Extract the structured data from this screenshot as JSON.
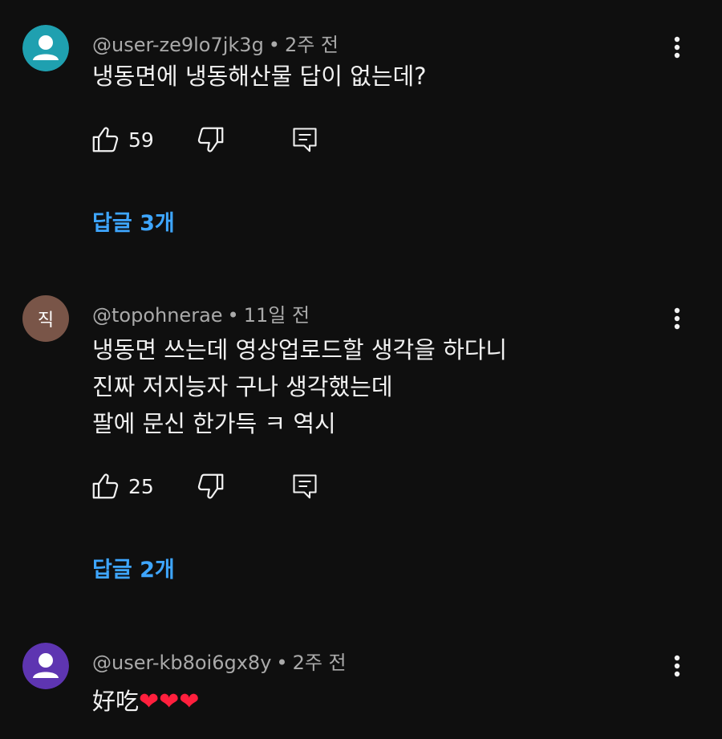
{
  "comments": [
    {
      "handle": "@user-ze9lo7jk3g",
      "separator": "•",
      "time": "2주 전",
      "avatar_color": "#1fa0b0",
      "avatar_type": "person-icon",
      "lines": [
        "냉동면에 냉동해산물 답이 없는데?"
      ],
      "likes": "59",
      "replies_label": "답글 3개"
    },
    {
      "handle": "@topohnerae",
      "separator": "•",
      "time": "11일 전",
      "avatar_color": "#795548",
      "avatar_letter": "직",
      "lines": [
        "냉동면 쓰는데 영상업로드할 생각을 하다니",
        "진짜 저지능자 구나 생각했는데",
        "팔에 문신 한가득 ㅋ 역시"
      ],
      "likes": "25",
      "replies_label": "답글 2개"
    },
    {
      "handle": "@user-kb8oi6gx8y",
      "separator": "•",
      "time": "2주 전",
      "avatar_color": "#5e35b1",
      "avatar_type": "person-icon",
      "text": "好吃",
      "hearts": "❤❤❤"
    }
  ],
  "icons": {
    "like": "thumbs-up-icon",
    "dislike": "thumbs-down-icon",
    "reply": "reply-icon",
    "more": "more-vert-icon"
  },
  "colors": {
    "background": "#0f0f0f",
    "text": "#f1f1f1",
    "meta": "#aaaaaa",
    "link": "#3ea6ff",
    "heart": "#ff1f3d"
  }
}
